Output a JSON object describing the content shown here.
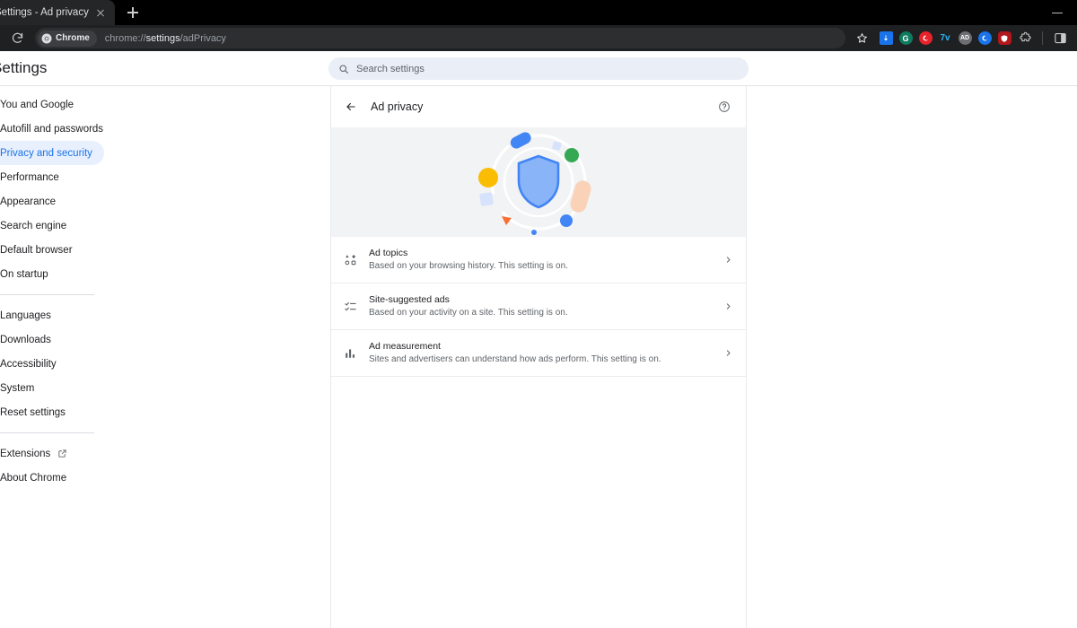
{
  "browser": {
    "tab": {
      "title": "Settings - Ad privacy",
      "close_icon": "close-icon"
    },
    "new_tab_label": "+",
    "minimize_label": "—",
    "reload_icon": "reload-icon",
    "omnibox": {
      "chip_label": "Chrome",
      "url_prefix": "chrome://",
      "url_emphasis": "settings",
      "url_suffix": "/adPrivacy"
    },
    "bookmark_icon": "star-icon",
    "extensions": [
      {
        "name": "download-extension-icon",
        "kind": "square",
        "color": "#1a73e8",
        "label": ""
      },
      {
        "name": "grammarly-extension-icon",
        "kind": "circle",
        "color": "#15c39a",
        "label": "G"
      },
      {
        "name": "red-extension-icon",
        "kind": "circle",
        "color": "#e8222a",
        "label": ""
      },
      {
        "name": "seven-v-extension-icon",
        "kind": "text",
        "color": "#29b6f6",
        "label": "7v"
      },
      {
        "name": "adblock-extension-icon",
        "kind": "circle",
        "color": "#7b7f83",
        "label": "AD"
      },
      {
        "name": "blue-extension-icon",
        "kind": "circle",
        "color": "#1a73e8",
        "label": ""
      },
      {
        "name": "shield-extension-icon",
        "kind": "circle",
        "color": "#c5221f",
        "label": ""
      }
    ],
    "puzzle_icon": "puzzle-piece-icon",
    "sidepanel_icon": "side-panel-icon"
  },
  "settings": {
    "title": "Settings",
    "search": {
      "placeholder": "Search settings",
      "value": "",
      "icon": "search-icon"
    },
    "nav": {
      "group1": [
        {
          "label": "You and Google",
          "selected": false
        },
        {
          "label": "Autofill and passwords",
          "selected": false
        },
        {
          "label": "Privacy and security",
          "selected": true
        },
        {
          "label": "Performance",
          "selected": false
        },
        {
          "label": "Appearance",
          "selected": false
        },
        {
          "label": "Search engine",
          "selected": false
        },
        {
          "label": "Default browser",
          "selected": false
        },
        {
          "label": "On startup",
          "selected": false
        }
      ],
      "group2": [
        {
          "label": "Languages",
          "selected": false
        },
        {
          "label": "Downloads",
          "selected": false
        },
        {
          "label": "Accessibility",
          "selected": false
        },
        {
          "label": "System",
          "selected": false
        },
        {
          "label": "Reset settings",
          "selected": false
        }
      ],
      "group3": [
        {
          "label": "Extensions",
          "selected": false,
          "external": true
        },
        {
          "label": "About Chrome",
          "selected": false,
          "external": false
        }
      ]
    }
  },
  "main": {
    "back_icon": "back-arrow-icon",
    "title": "Ad privacy",
    "help_icon": "help-circle-icon",
    "hero": {
      "name": "ad-privacy-shield-illustration",
      "shield_fill": "#8ab4f8",
      "shield_stroke": "#4285f4",
      "accent_blue": "#4285f4",
      "accent_yellow": "#fbbc04",
      "accent_green": "#34a853",
      "accent_peach": "#fad2b8",
      "accent_orange": "#f96f35",
      "band_background": "#f1f3f4"
    },
    "rows": [
      {
        "icon": "ad-topics-icon",
        "title": "Ad topics",
        "subtitle": "Based on your browsing history. This setting is on.",
        "arrow": "chevron-right-icon"
      },
      {
        "icon": "site-suggested-ads-icon",
        "title": "Site-suggested ads",
        "subtitle": "Based on your activity on a site. This setting is on.",
        "arrow": "chevron-right-icon"
      },
      {
        "icon": "ad-measurement-icon",
        "title": "Ad measurement",
        "subtitle": "Sites and advertisers can understand how ads perform. This setting is on.",
        "arrow": "chevron-right-icon"
      }
    ]
  }
}
